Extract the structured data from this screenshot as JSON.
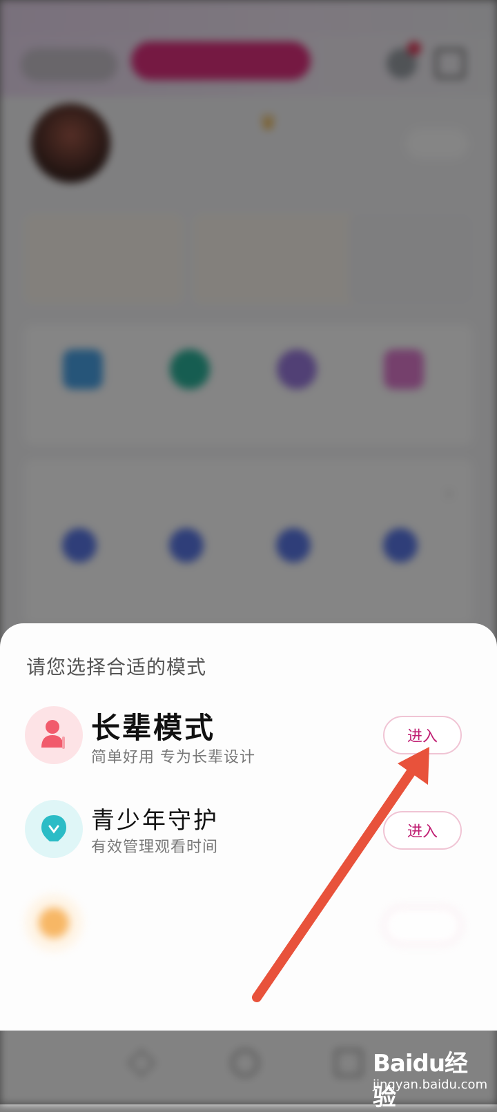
{
  "background": {
    "status": {
      "time": "",
      "right": ""
    },
    "top_bar": {
      "vip_label": ""
    },
    "profile": {
      "name": "",
      "level": "",
      "stats": "",
      "button": ""
    },
    "cards": [
      {
        "title": "",
        "sub": ""
      },
      {
        "title": "",
        "sub": ""
      },
      {
        "title": "",
        "sub": ""
      }
    ],
    "grid": [
      {
        "label": "",
        "color": "#4aa3e8"
      },
      {
        "label": "",
        "color": "#2bb39b"
      },
      {
        "label": "",
        "color": "#9b7be0"
      },
      {
        "label": "",
        "color": "#e07bd0"
      }
    ],
    "service": {
      "title": "",
      "items": [
        "",
        "",
        "",
        ""
      ]
    }
  },
  "sheet": {
    "title": "请您选择合适的模式",
    "modes": [
      {
        "name": "长辈模式",
        "desc": "简单好用 专为长辈设计",
        "button": "进入",
        "icon": "elder-person-icon",
        "icon_bg": "#fde3e6",
        "icon_color": "#f15b6c"
      },
      {
        "name": "青少年守护",
        "desc": "有效管理观看时间",
        "button": "进入",
        "icon": "teen-shield-icon",
        "icon_bg": "#dff6f7",
        "icon_color": "#2bbcc6"
      },
      {
        "name": "",
        "desc": "",
        "button": "",
        "icon": "child-icon",
        "icon_bg": "#fff2e0",
        "icon_color": "#f6a033"
      }
    ],
    "cancel": ""
  },
  "annotation": {
    "arrow_color": "#e8523b"
  },
  "watermark": {
    "logo": "Baidu经验",
    "url": "jingyan.baidu.com"
  },
  "colors": {
    "accent": "#c01f73",
    "vip": "#e0307f"
  }
}
